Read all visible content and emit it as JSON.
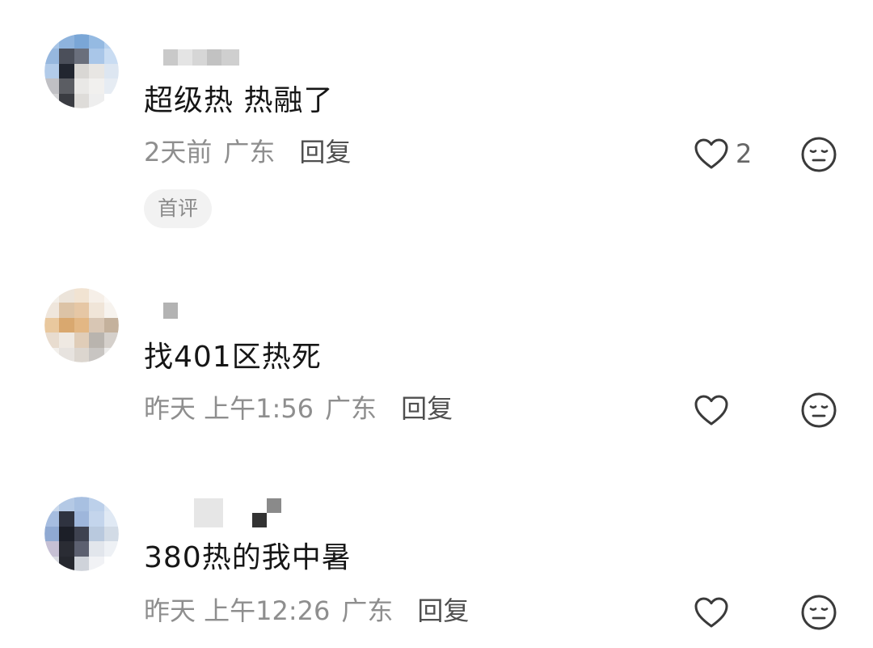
{
  "comments": [
    {
      "content": "超级热 热融了",
      "time": "2天前",
      "location": "广东",
      "reply_label": "回复",
      "like_count": "2",
      "badge": "首评"
    },
    {
      "content": "找401区热死",
      "time": "昨天 上午1:56",
      "location": "广东",
      "reply_label": "回复",
      "like_count": "",
      "badge": ""
    },
    {
      "content": "380热的我中暑",
      "time": "昨天 上午12:26",
      "location": "广东",
      "reply_label": "回复",
      "like_count": "",
      "badge": ""
    }
  ],
  "icons": {
    "like": "heart-outline-icon",
    "dislike": "neutral-face-icon"
  },
  "colors": {
    "text_primary": "#161616",
    "text_meta": "#8e8e8e",
    "reply": "#4f4f4f",
    "icon": "#3a3a3a",
    "badge_bg": "#f2f2f2"
  }
}
